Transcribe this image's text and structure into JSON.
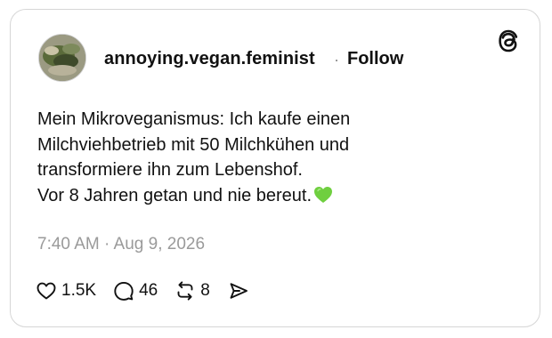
{
  "post": {
    "username": "annoying.vegan.feminist",
    "separator": "·",
    "follow_label": "Follow",
    "text_lines": [
      "Mein Mikroveganismus: Ich kaufe einen",
      "Milchviehbetrieb mit 50 Milchkühen und",
      "transformiere ihn zum Lebenshof.",
      "Vor 8 Jahren getan und nie bereut."
    ],
    "trailing_emoji": "green-heart-emoji",
    "timestamp": "7:40 AM · Aug 9, 2026"
  },
  "actions": {
    "likes": "1.5K",
    "replies": "46",
    "reposts": "8"
  },
  "icons": {
    "brand": "threads-logo-icon",
    "like": "heart-icon",
    "reply": "speech-bubble-icon",
    "repost": "repost-icon",
    "share": "send-icon"
  },
  "colors": {
    "text": "#111111",
    "muted": "#9a9a9a",
    "border": "#d6d6d6",
    "heart_emoji": "#6fcf3f"
  }
}
